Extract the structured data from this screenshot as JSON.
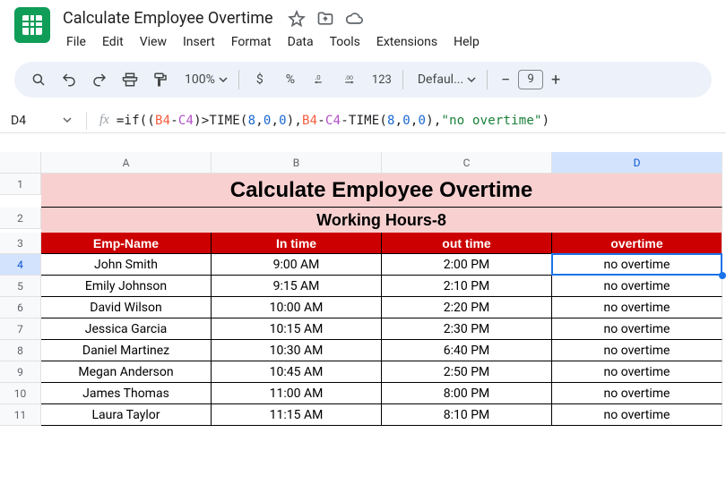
{
  "doc": {
    "title": "Calculate Employee Overtime"
  },
  "menus": [
    "File",
    "Edit",
    "View",
    "Insert",
    "Format",
    "Data",
    "Tools",
    "Extensions",
    "Help"
  ],
  "toolbar": {
    "zoom": "100%",
    "font": "Defaul...",
    "fontsize": "9",
    "num_fmt_123": "123"
  },
  "formulabar": {
    "namebox": "D4",
    "tokens": [
      {
        "cls": "plain",
        "t": "=if(("
      },
      {
        "cls": "ref1",
        "t": "B4"
      },
      {
        "cls": "plain",
        "t": "-"
      },
      {
        "cls": "ref2",
        "t": "C4"
      },
      {
        "cls": "plain",
        "t": ")>TIME("
      },
      {
        "cls": "num",
        "t": "8"
      },
      {
        "cls": "plain",
        "t": ","
      },
      {
        "cls": "num",
        "t": "0"
      },
      {
        "cls": "plain",
        "t": ","
      },
      {
        "cls": "num",
        "t": "0"
      },
      {
        "cls": "plain",
        "t": "),"
      },
      {
        "cls": "ref1",
        "t": "B4"
      },
      {
        "cls": "plain",
        "t": "-"
      },
      {
        "cls": "ref2",
        "t": "C4"
      },
      {
        "cls": "plain",
        "t": "-TIME("
      },
      {
        "cls": "num",
        "t": "8"
      },
      {
        "cls": "plain",
        "t": ","
      },
      {
        "cls": "num",
        "t": "0"
      },
      {
        "cls": "plain",
        "t": ","
      },
      {
        "cls": "num",
        "t": "0"
      },
      {
        "cls": "plain",
        "t": "),"
      },
      {
        "cls": "str",
        "t": "\"no overtime\""
      },
      {
        "cls": "plain",
        "t": ")"
      }
    ]
  },
  "cols": [
    "A",
    "B",
    "C",
    "D"
  ],
  "sheet": {
    "title": "Calculate Employee Overtime",
    "subtitle": "Working Hours-8",
    "headers": [
      "Emp-Name",
      "In time",
      "out time",
      "overtime"
    ],
    "rows": [
      {
        "n": "4",
        "name": "John Smith",
        "in": "9:00 AM",
        "out": "2:00 PM",
        "ot": "no overtime"
      },
      {
        "n": "5",
        "name": "Emily Johnson",
        "in": "9:15 AM",
        "out": "2:10 PM",
        "ot": "no overtime"
      },
      {
        "n": "6",
        "name": "David Wilson",
        "in": "10:00 AM",
        "out": "2:20 PM",
        "ot": "no overtime"
      },
      {
        "n": "7",
        "name": "Jessica Garcia",
        "in": "10:15 AM",
        "out": "2:30 PM",
        "ot": "no overtime"
      },
      {
        "n": "8",
        "name": "Daniel Martinez",
        "in": "10:30 AM",
        "out": "6:40 PM",
        "ot": "no overtime"
      },
      {
        "n": "9",
        "name": "Megan Anderson",
        "in": "10:45 AM",
        "out": "2:50 PM",
        "ot": "no overtime"
      },
      {
        "n": "10",
        "name": "James Thomas",
        "in": "11:00 AM",
        "out": "8:00 PM",
        "ot": "no overtime"
      },
      {
        "n": "11",
        "name": "Laura Taylor",
        "in": "11:15 AM",
        "out": "8:10 PM",
        "ot": "no overtime"
      }
    ]
  },
  "selection": {
    "col": "D",
    "row": "4"
  }
}
